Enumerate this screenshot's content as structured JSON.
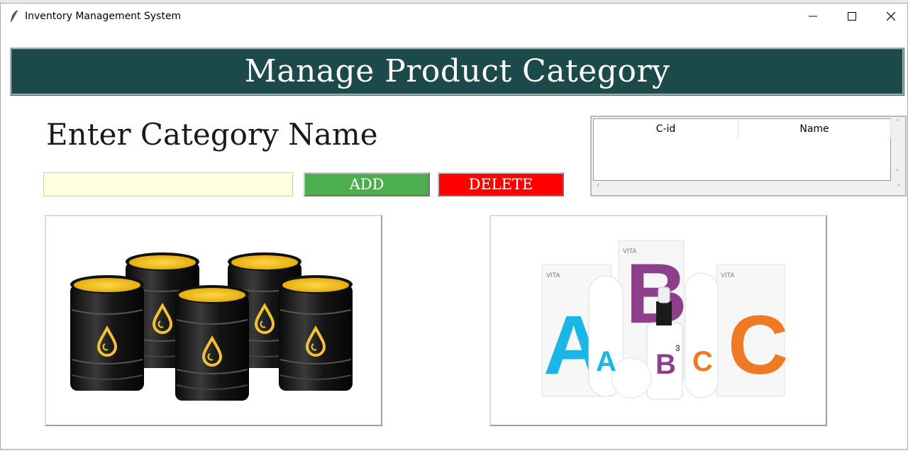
{
  "window": {
    "title": "Inventory Management System",
    "controls": [
      "minimize",
      "maximize",
      "close"
    ]
  },
  "header": {
    "title": "Manage Product Category",
    "bg_color": "#1c4a4a"
  },
  "form": {
    "label": "Enter Category Name",
    "category_input_value": "",
    "add_label": "ADD",
    "delete_label": "DELETE",
    "add_color": "#4cae4c",
    "delete_color": "#ff0000"
  },
  "table": {
    "columns": [
      "C-id",
      "Name"
    ],
    "rows": []
  },
  "images": {
    "left_icon": "oil-barrels-image",
    "right_icon": "vitamin-bottles-image",
    "right_text": {
      "brand": "VITA",
      "letter_a": "A",
      "letter_b": "B",
      "letter_c": "C",
      "superscript": "3"
    }
  }
}
